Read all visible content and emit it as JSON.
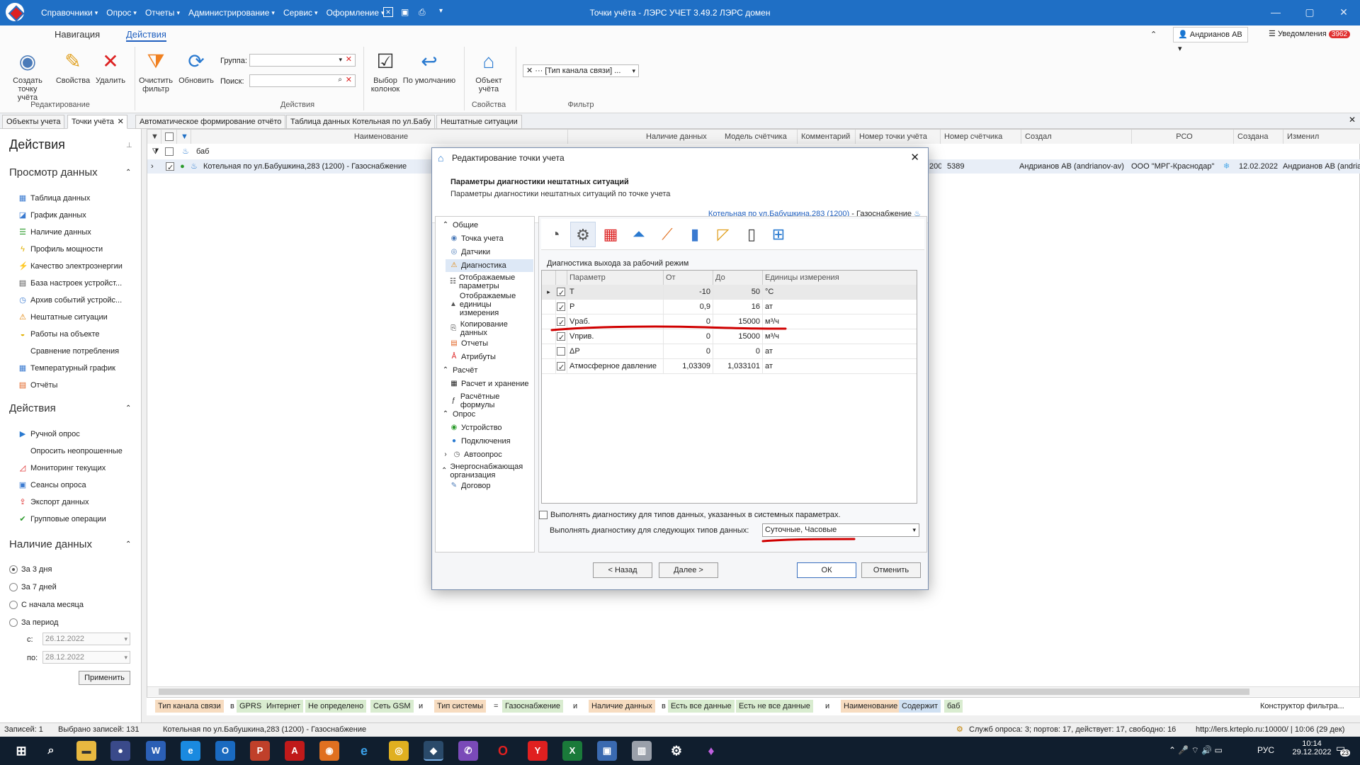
{
  "window": {
    "title": "Точки учёта - ЛЭРС УЧЕТ 3.49.2 ЛЭРС домен"
  },
  "menu": [
    "Справочники",
    "Опрос",
    "Отчеты",
    "Администрирование",
    "Сервис",
    "Оформление"
  ],
  "ribbon": {
    "tabs": [
      "Навигация",
      "Действия"
    ],
    "active_tab": "Действия",
    "buttons": {
      "create": "Создать точку учёта",
      "properties": "Свойства",
      "delete": "Удалить",
      "clear_filter": "Очистить фильтр",
      "refresh": "Обновить",
      "choose_columns": "Выбор колонок",
      "default": "По умолчанию",
      "object": "Объект учёта"
    },
    "group_label": "Группа:",
    "search_label": "Поиск:",
    "filter_token": "[Тип канала связи] ...",
    "groups": {
      "edit": "Редактирование",
      "actions": "Действия",
      "properties": "Свойства",
      "filter": "Фильтр"
    },
    "user": "Андрианов АВ",
    "notifications": "Уведомления",
    "notif_count": "3962"
  },
  "doc_tabs": [
    "Объекты учета",
    "Точки учёта",
    "Автоматическое формирование отчёто",
    "Таблица данных Котельная по ул.Бабу",
    "Нештатные ситуации"
  ],
  "left_panel": {
    "title": "Действия",
    "sections": {
      "view": {
        "title": "Просмотр данных",
        "items": [
          "Таблица данных",
          "График данных",
          "Наличие данных",
          "Профиль мощности",
          "Качество электроэнергии",
          "База настроек устройст...",
          "Архив событий устройс...",
          "Нештатные ситуации",
          "Работы на объекте",
          "Сравнение потребления",
          "Температурный график",
          "Отчёты"
        ]
      },
      "actions": {
        "title": "Действия",
        "items": [
          "Ручной опрос",
          "Опросить неопрошенные",
          "Мониторинг текущих",
          "Сеансы опроса",
          "Экспорт данных",
          "Групповые операции"
        ]
      },
      "availability": {
        "title": "Наличие данных",
        "options": [
          "За 3 дня",
          "За 7 дней",
          "С начала месяца",
          "За период"
        ],
        "selected": "За 3 дня",
        "from_label": "с:",
        "to_label": "по:",
        "from": "26.12.2022",
        "to": "28.12.2022",
        "apply": "Применить"
      }
    }
  },
  "grid": {
    "columns": [
      "Наименование",
      "Наличие данных",
      "Модель счётчика",
      "Комментарий",
      "Номер точки учёта",
      "Номер счётчика",
      "Создал",
      "РСО",
      "Создана",
      "Изменил"
    ],
    "filter_text": "баб",
    "row": {
      "name": "Котельная по ул.Бабушкина,283 (1200) - Газоснабжение",
      "point_no": "200",
      "meter_no": "5389",
      "created_by": "Андрианов АВ (andrianov-av)",
      "rso": "ООО \"МРГ-Краснодар\"",
      "created": "12.02.2022",
      "modified_by": "Андрианов АВ (andrian"
    }
  },
  "filter_bar": {
    "chips": [
      "Тип канала связи",
      "в",
      "GPRS",
      "Интернет",
      "Не определено",
      "Сеть GSM",
      "и",
      "Тип системы",
      "=",
      "Газоснабжение",
      "и",
      "Наличие данных",
      "в",
      "Есть все данные",
      "Есть не все данные",
      "и",
      "Наименование",
      "Содержит",
      "баб"
    ],
    "constructor": "Конструктор фильтра..."
  },
  "status": {
    "records": "Записей: 1",
    "selected": "Выбрано записей: 131",
    "current": "Котельная по ул.Бабушкина,283 (1200) - Газоснабжение",
    "services": "Служб опроса: 3; портов: 17, действует: 17, свободно: 16",
    "server": "http://lers.krteplo.ru:10000/ | 10:06 (29 дек)"
  },
  "dialog": {
    "title": "Редактирование точки учета",
    "header": "Параметры диагностики нештатных ситуаций",
    "subheader": "Параметры диагностики нештатных ситуаций по точке учета",
    "link": "Котельная по ул.Бабушкина,283 (1200)",
    "link_suffix": "- Газоснабжение",
    "tree": {
      "general": "Общие",
      "general_items": [
        "Точка учета",
        "Датчики",
        "Диагностика",
        "Отображаемые параметры",
        "Отображаемые единицы измерения",
        "Копирование данных",
        "Отчеты",
        "Атрибуты"
      ],
      "calc": "Расчёт",
      "calc_items": [
        "Расчет и хранение",
        "Расчётные формулы"
      ],
      "poll": "Опрос",
      "poll_items": [
        "Устройство",
        "Подключения",
        "Автоопрос"
      ],
      "energy": "Энергоснабжающая организация",
      "energy_items": [
        "Договор"
      ]
    },
    "section_title": "Диагностика выхода за рабочий режим",
    "table_headers": [
      "Параметр",
      "От",
      "До",
      "Единицы измерения"
    ],
    "rows": [
      {
        "checked": true,
        "param": "T",
        "from": "-10",
        "to": "50",
        "unit": "°C"
      },
      {
        "checked": true,
        "param": "P",
        "from": "0,9",
        "to": "16",
        "unit": "ат"
      },
      {
        "checked": true,
        "param": "Vраб.",
        "from": "0",
        "to": "15000",
        "unit": "м³/ч"
      },
      {
        "checked": true,
        "param": "Vприв.",
        "from": "0",
        "to": "15000",
        "unit": "м³/ч"
      },
      {
        "checked": false,
        "param": "ΔP",
        "from": "0",
        "to": "0",
        "unit": "ат"
      },
      {
        "checked": true,
        "param": "Атмосферное давление",
        "from": "1,03309",
        "to": "1,033101",
        "unit": "ат"
      }
    ],
    "sys_check_label": "Выполнять диагностику для типов данных, указанных в системных параметрах.",
    "types_label": "Выполнять диагностику для следующих типов данных:",
    "types_value": "Суточные, Часовые",
    "buttons": {
      "back": "< Назад",
      "next": "Далее >",
      "ok": "ОК",
      "cancel": "Отменить"
    }
  },
  "taskbar": {
    "lang": "РУС",
    "time": "10:14",
    "date": "29.12.2022",
    "badge": "23"
  },
  "colors": {
    "accent": "#1f6fc5",
    "annotation": "#d00000"
  }
}
